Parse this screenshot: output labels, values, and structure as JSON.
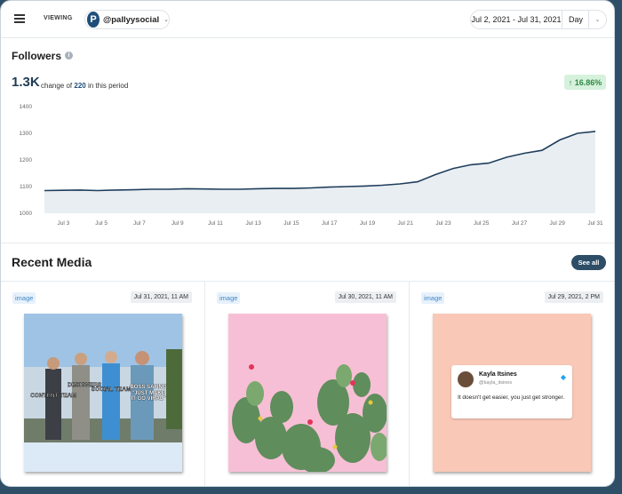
{
  "topbar": {
    "viewing_label": "VIEWING",
    "viewing_chevron": "›",
    "account_logo_letter": "P",
    "account_name": "@pallyysocial",
    "account_chevron": "⌄",
    "date_range": "Jul 2, 2021 - Jul 31, 2021",
    "period": "Day",
    "period_chevron": "⌄"
  },
  "followers": {
    "title": "Followers",
    "info_glyph": "i",
    "total": "1.3K",
    "change_prefix": "change of",
    "change_value": "220",
    "change_suffix": "in this period",
    "growth": "↑ 16.86%",
    "growth_color": "#2f8a45"
  },
  "chart_data": {
    "type": "area",
    "title": "",
    "xlabel": "",
    "ylabel": "",
    "ylim": [
      1000,
      1400
    ],
    "y_ticks": [
      "1000",
      "1100",
      "1200",
      "1300",
      "1400"
    ],
    "x_ticks": [
      "Jul 3",
      "Jul 5",
      "Jul 7",
      "Jul 9",
      "Jul 11",
      "Jul 13",
      "Jul 15",
      "Jul 17",
      "Jul 19",
      "Jul 21",
      "Jul 23",
      "Jul 25",
      "Jul 27",
      "Jul 29",
      "Jul 31"
    ],
    "x": [
      "Jul 2",
      "Jul 3",
      "Jul 4",
      "Jul 5",
      "Jul 6",
      "Jul 7",
      "Jul 8",
      "Jul 9",
      "Jul 10",
      "Jul 11",
      "Jul 12",
      "Jul 13",
      "Jul 14",
      "Jul 15",
      "Jul 16",
      "Jul 17",
      "Jul 18",
      "Jul 19",
      "Jul 20",
      "Jul 21",
      "Jul 22",
      "Jul 23",
      "Jul 24",
      "Jul 25",
      "Jul 26",
      "Jul 27",
      "Jul 28",
      "Jul 29",
      "Jul 30",
      "Jul 31"
    ],
    "series": [
      {
        "values": [
          1085,
          1086,
          1087,
          1085,
          1087,
          1088,
          1090,
          1090,
          1092,
          1091,
          1090,
          1090,
          1092,
          1093,
          1093,
          1095,
          1098,
          1100,
          1102,
          1105,
          1110,
          1118,
          1145,
          1168,
          1182,
          1188,
          1210,
          1225,
          1236,
          1275,
          1300,
          1307
        ],
        "color": "#1f3e5c",
        "fill": "#e9eef2"
      }
    ],
    "grid": false,
    "legend": "none"
  },
  "recent_media": {
    "title": "Recent Media",
    "see_all": "See all",
    "items": [
      {
        "type": "image",
        "date": "Jul 31, 2021, 11 AM"
      },
      {
        "type": "image",
        "date": "Jul 30, 2021, 11 AM"
      },
      {
        "type": "image",
        "date": "Jul 29, 2021, 2 PM"
      }
    ],
    "meme_labels": [
      "CONTENT TEAM",
      "DESIGNERS",
      "SOCIAL TEAM",
      "BOSS SAYING \"JUST MAKE IT GO VIRAL\""
    ],
    "tweet": {
      "name": "Kayla Itsines",
      "handle": "@kayla_itsines",
      "text": "It doesn't get easier, you just get stronger."
    }
  }
}
